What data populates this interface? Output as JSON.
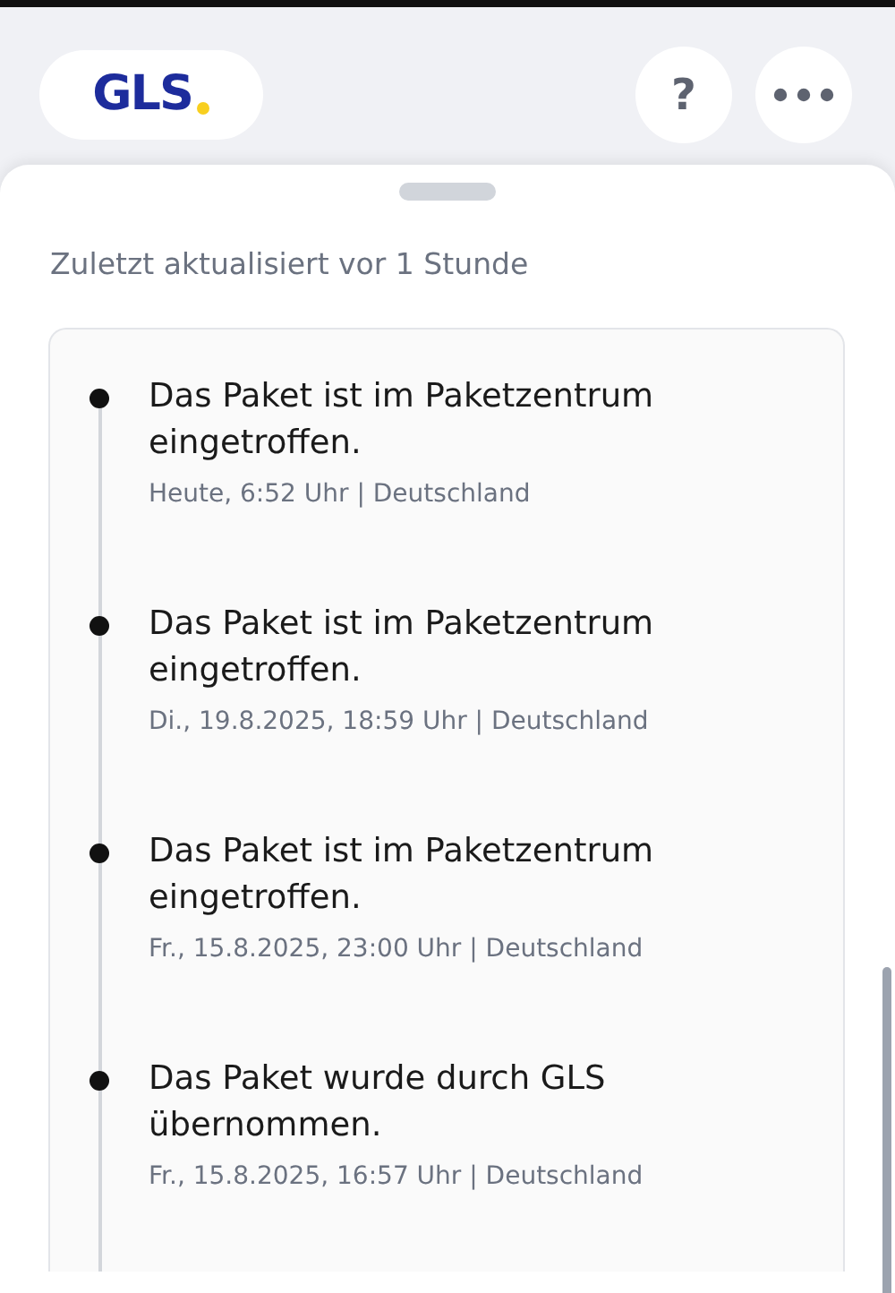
{
  "header": {
    "logo": "GLS",
    "help_button": "?"
  },
  "sheet": {
    "subtitle": "Zuletzt aktualisiert vor 1 Stunde"
  },
  "events": [
    {
      "title": "Das Paket ist im Paketzentrum eingetroffen.",
      "meta": "Heute, 6:52 Uhr | Deutschland"
    },
    {
      "title": "Das Paket ist im Paketzentrum eingetroffen.",
      "meta": "Di., 19.8.2025, 18:59 Uhr | Deutschland"
    },
    {
      "title": "Das Paket ist im Paketzentrum eingetroffen.",
      "meta": "Fr., 15.8.2025, 23:00 Uhr | Deutschland"
    },
    {
      "title": "Das Paket wurde durch GLS übernommen.",
      "meta": "Fr., 15.8.2025, 16:57 Uhr | Deutschland"
    }
  ]
}
